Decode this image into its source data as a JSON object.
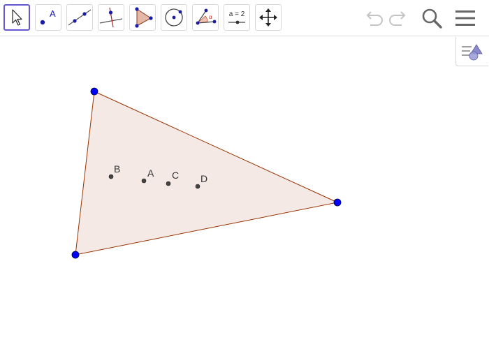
{
  "toolbar": {
    "tools": [
      {
        "name": "move-tool",
        "selected": true
      },
      {
        "name": "point-tool",
        "icon_label": "A"
      },
      {
        "name": "line-tool"
      },
      {
        "name": "perpendicular-line-tool"
      },
      {
        "name": "polygon-tool"
      },
      {
        "name": "circle-tool"
      },
      {
        "name": "angle-tool",
        "icon_label": "α"
      },
      {
        "name": "slider-tool",
        "icon_label": "a = 2"
      },
      {
        "name": "move-graphics-view-tool"
      }
    ],
    "actions": [
      "undo",
      "redo",
      "search",
      "menu"
    ]
  },
  "style_bar": {
    "icon": "graphics-style-toggle-icon"
  },
  "construction": {
    "polygon": {
      "fill": "#f4e9e4",
      "stroke": "#993300"
    },
    "vertex_color": "#0000ff",
    "points": [
      {
        "label": "B"
      },
      {
        "label": "A"
      },
      {
        "label": "C"
      },
      {
        "label": "D"
      }
    ]
  }
}
